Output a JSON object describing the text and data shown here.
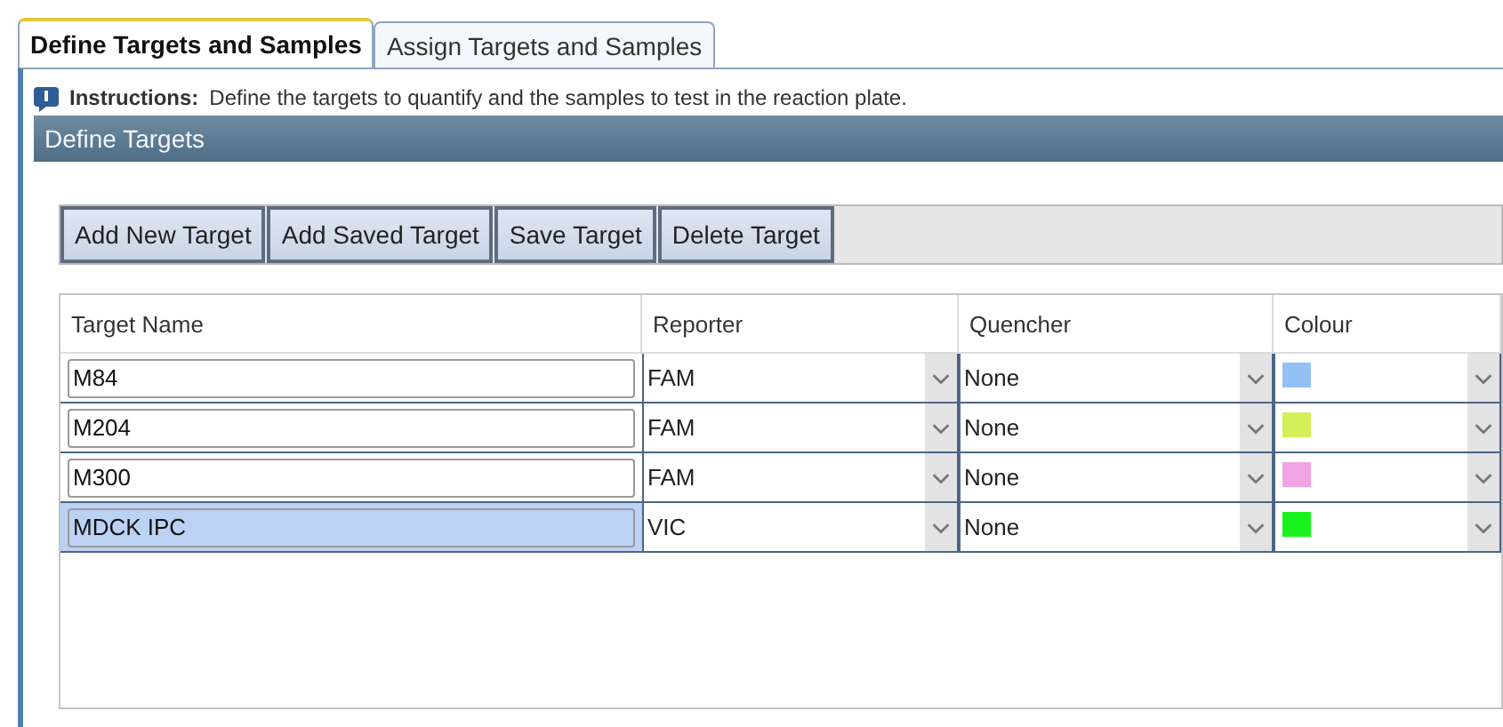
{
  "tabs": [
    {
      "label": "Define Targets and Samples",
      "selected": true
    },
    {
      "label": "Assign Targets and Samples",
      "selected": false
    }
  ],
  "instructions": {
    "label": "Instructions:",
    "text": "Define the targets to quantify and the samples to test in the reaction plate."
  },
  "panel": {
    "title": "Define Targets"
  },
  "toolbar": [
    "Add New Target",
    "Add Saved Target",
    "Save Target",
    "Delete Target"
  ],
  "table": {
    "columns": [
      "Target Name",
      "Reporter",
      "Quencher",
      "Colour"
    ],
    "rows": [
      {
        "name": "M84",
        "reporter": "FAM",
        "quencher": "None",
        "color": "#93c0f5",
        "selected": false
      },
      {
        "name": "M204",
        "reporter": "FAM",
        "quencher": "None",
        "color": "#d4ef5a",
        "selected": false
      },
      {
        "name": "M300",
        "reporter": "FAM",
        "quencher": "None",
        "color": "#f2a3e4",
        "selected": false
      },
      {
        "name": "MDCK IPC",
        "reporter": "VIC",
        "quencher": "None",
        "color": "#19f21c",
        "selected": true
      }
    ]
  }
}
